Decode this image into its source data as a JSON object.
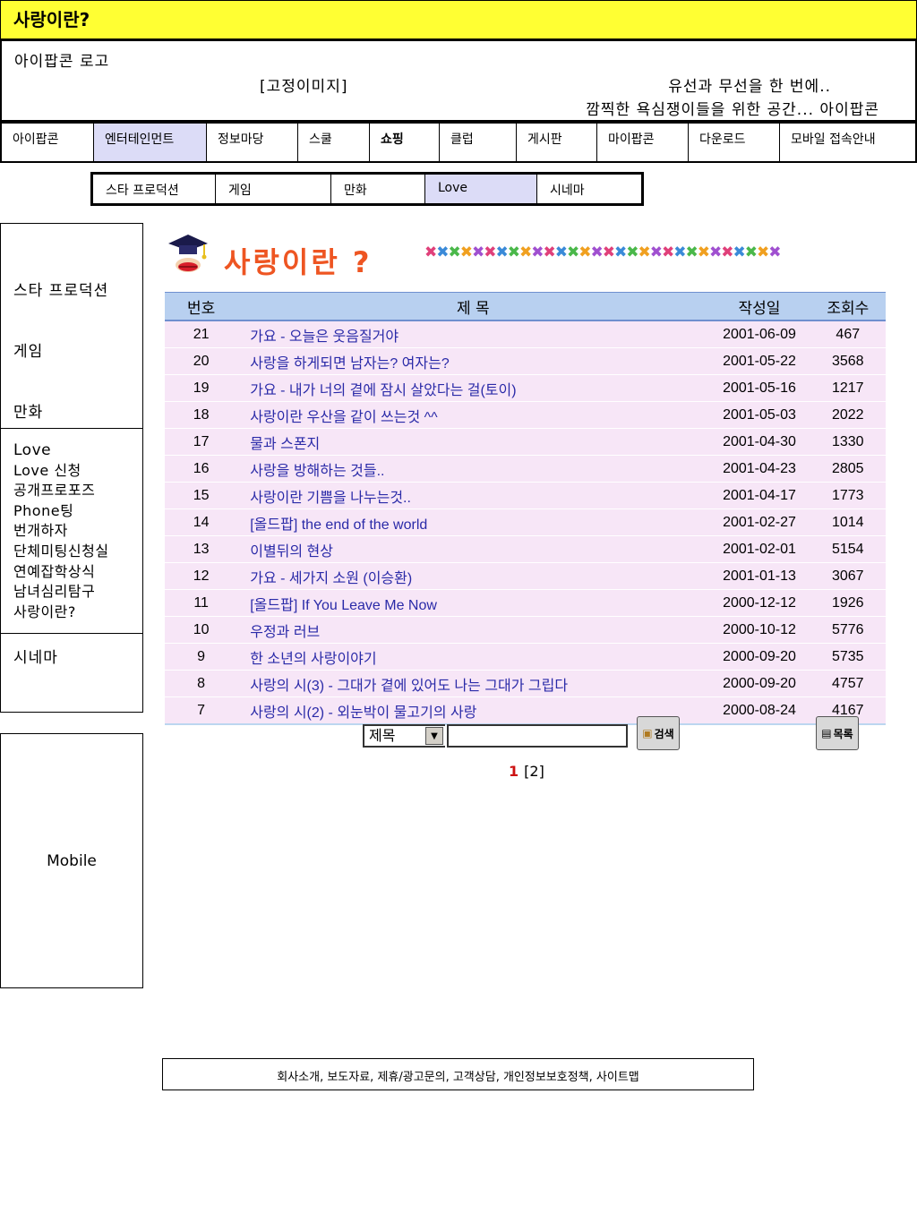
{
  "page_title": "사랑이란?",
  "header": {
    "logo": "아이팝콘 로고",
    "fixed_image": "[고정이미지]",
    "slogan_line1": "유선과 무선을 한 번에..",
    "slogan_line2": "깜찍한 욕심쟁이들을 위한 공간... 아이팝콘"
  },
  "main_nav": [
    {
      "label": "아이팝콘"
    },
    {
      "label": "엔터테인먼트"
    },
    {
      "label": "정보마당"
    },
    {
      "label": "스쿨"
    },
    {
      "label": "쇼핑"
    },
    {
      "label": "클럽"
    },
    {
      "label": "게시판"
    },
    {
      "label": "마이팝콘"
    },
    {
      "label": "다운로드"
    },
    {
      "label": "모바일 접속안내"
    }
  ],
  "sub_nav": [
    {
      "label": "스타 프로덕션"
    },
    {
      "label": "게임"
    },
    {
      "label": "만화"
    },
    {
      "label": "Love"
    },
    {
      "label": "시네마"
    }
  ],
  "sidebar": {
    "star": "스타 프로덕션",
    "game": "게임",
    "comic": "만화",
    "love_items": [
      "Love",
      "Love 신청",
      "공개프로포즈",
      "Phone팅",
      "번개하자",
      "단체미팅신청실",
      "연예잡학상식",
      "남녀심리탐구",
      "사랑이란?"
    ],
    "cinema": "시네마",
    "mobile": "Mobile"
  },
  "board": {
    "title": "사랑이란 ?",
    "decoration": "✖✖✖✖✖✖✖✖✖✖✖✖✖✖✖✖✖✖✖✖✖✖✖✖✖✖✖✖✖✖",
    "columns": {
      "no": "번호",
      "subject": "제    목",
      "date": "작성일",
      "views": "조회수"
    },
    "rows": [
      {
        "no": "21",
        "subject": "가요 - 오늘은 웃음질거야",
        "date": "2001-06-09",
        "views": "467"
      },
      {
        "no": "20",
        "subject": "사랑을 하게되면 남자는? 여자는?",
        "date": "2001-05-22",
        "views": "3568"
      },
      {
        "no": "19",
        "subject": "가요 - 내가 너의 곁에 잠시 살았다는 걸(토이)",
        "date": "2001-05-16",
        "views": "1217"
      },
      {
        "no": "18",
        "subject": "사랑이란 우산을 같이 쓰는것 ^^",
        "date": "2001-05-03",
        "views": "2022"
      },
      {
        "no": "17",
        "subject": "물과 스폰지",
        "date": "2001-04-30",
        "views": "1330"
      },
      {
        "no": "16",
        "subject": "사랑을 방해하는 것들..",
        "date": "2001-04-23",
        "views": "2805"
      },
      {
        "no": "15",
        "subject": "사랑이란 기쁨을 나누는것..",
        "date": "2001-04-17",
        "views": "1773"
      },
      {
        "no": "14",
        "subject": "[올드팝] the end of the world",
        "date": "2001-02-27",
        "views": "1014"
      },
      {
        "no": "13",
        "subject": "이별뒤의 현상",
        "date": "2001-02-01",
        "views": "5154"
      },
      {
        "no": "12",
        "subject": "가요 - 세가지 소원 (이승환)",
        "date": "2001-01-13",
        "views": "3067"
      },
      {
        "no": "11",
        "subject": "[올드팝] If You Leave Me Now",
        "date": "2000-12-12",
        "views": "1926"
      },
      {
        "no": "10",
        "subject": "우정과 러브",
        "date": "2000-10-12",
        "views": "5776"
      },
      {
        "no": "9",
        "subject": "한 소년의 사랑이야기",
        "date": "2000-09-20",
        "views": "5735"
      },
      {
        "no": "8",
        "subject": "사랑의 시(3) - 그대가 곁에 있어도 나는 그대가 그립다",
        "date": "2000-09-20",
        "views": "4757"
      },
      {
        "no": "7",
        "subject": "사랑의 시(2) - 외눈박이 물고기의 사랑",
        "date": "2000-08-24",
        "views": "4167"
      }
    ]
  },
  "search": {
    "field_selected": "제목",
    "input_value": "",
    "search_button": "검색",
    "list_button": "목록"
  },
  "pagination": {
    "current": "1",
    "other": "[2]"
  },
  "footer": "회사소개, 보도자료, 제휴/광고문의, 고객상담, 개인정보보호정책, 사이트맵",
  "colors": {
    "title_bar": "#ffff33",
    "active_tab": "#dcdcf7",
    "table_header": "#b8d0f0",
    "row_bg": "#f7e6f7",
    "subject_text": "#2a2aa8",
    "board_title": "#ee5522"
  },
  "icons": [
    "graduation-cap-icon",
    "lips-icon",
    "search-folder-icon",
    "list-folder-icon",
    "dropdown-arrow-icon"
  ]
}
